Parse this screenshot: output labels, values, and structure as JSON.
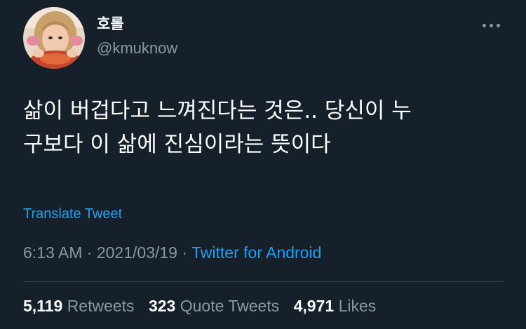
{
  "user": {
    "display_name": "호롤",
    "handle": "@kmuknow"
  },
  "icons": {
    "more": "more-horizontal-icon",
    "avatar": "profile-photo"
  },
  "tweet": {
    "text": "삶이 버겁다고 느껴진다는 것은.. 당신이 누\n구보다 이 삶에 진심이라는 뜻이다",
    "translate_label": "Translate Tweet"
  },
  "meta": {
    "time": "6:13 AM",
    "separator": "·",
    "date": "2021/03/19",
    "source": "Twitter for Android"
  },
  "stats": {
    "retweets_count": "5,119",
    "retweets_label": "Retweets",
    "quotes_count": "323",
    "quotes_label": "Quote Tweets",
    "likes_count": "4,971",
    "likes_label": "Likes"
  },
  "colors": {
    "background": "#15202b",
    "text_primary": "#ffffff",
    "text_secondary": "#8899a6",
    "accent": "#1da1f2",
    "divider": "#38444d"
  }
}
